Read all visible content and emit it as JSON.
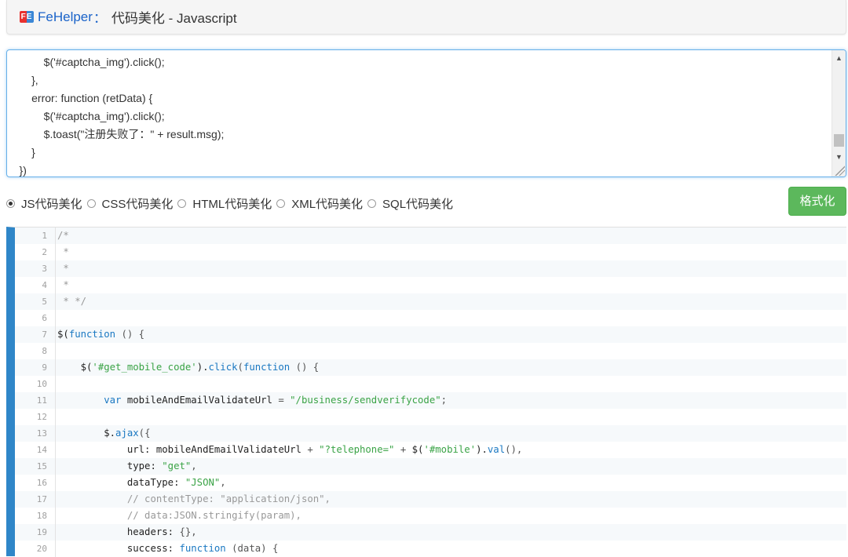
{
  "header": {
    "brand": "FeHelper",
    "separator": "：",
    "title": "代码美化 - Javascript",
    "logo_text": "FE"
  },
  "source": {
    "lines": [
      "            $('#captcha_img').click();",
      "        },",
      "        error: function (retData) {",
      "            $('#captcha_img').click();",
      "            $.toast(\"注册失败了：\" + result.msg);",
      "        }",
      "    })"
    ]
  },
  "options": [
    {
      "label": "JS代码美化",
      "checked": true
    },
    {
      "label": "CSS代码美化",
      "checked": false
    },
    {
      "label": "HTML代码美化",
      "checked": false
    },
    {
      "label": "XML代码美化",
      "checked": false
    },
    {
      "label": "SQL代码美化",
      "checked": false
    }
  ],
  "format_button": "格式化",
  "result": {
    "lines": [
      {
        "n": "1",
        "tokens": [
          [
            "c-com",
            "/*"
          ]
        ]
      },
      {
        "n": "2",
        "tokens": [
          [
            "c-com",
            " *"
          ]
        ]
      },
      {
        "n": "3",
        "tokens": [
          [
            "c-com",
            " *"
          ]
        ]
      },
      {
        "n": "4",
        "tokens": [
          [
            "c-com",
            " *"
          ]
        ]
      },
      {
        "n": "5",
        "tokens": [
          [
            "c-com",
            " * */"
          ]
        ]
      },
      {
        "n": "6",
        "tokens": []
      },
      {
        "n": "7",
        "tokens": [
          [
            "c-fn",
            "$("
          ],
          [
            "c-kw",
            "function"
          ],
          [
            "c-pun",
            " () {"
          ]
        ]
      },
      {
        "n": "8",
        "tokens": []
      },
      {
        "n": "9",
        "tokens": [
          [
            "c-fn",
            "    $("
          ],
          [
            "c-str",
            "'#get_mobile_code'"
          ],
          [
            "c-fn",
            ")."
          ],
          [
            "c-kw",
            "click"
          ],
          [
            "c-pun",
            "("
          ],
          [
            "c-kw",
            "function"
          ],
          [
            "c-pun",
            " () {"
          ]
        ]
      },
      {
        "n": "10",
        "tokens": []
      },
      {
        "n": "11",
        "tokens": [
          [
            "c-kw",
            "        var"
          ],
          [
            "c-fn",
            " mobileAndEmailValidateUrl "
          ],
          [
            "c-pun",
            "= "
          ],
          [
            "c-str",
            "\"/business/sendverifycode\""
          ],
          [
            "c-pun",
            ";"
          ]
        ]
      },
      {
        "n": "12",
        "tokens": []
      },
      {
        "n": "13",
        "tokens": [
          [
            "c-fn",
            "        $."
          ],
          [
            "c-kw",
            "ajax"
          ],
          [
            "c-pun",
            "({"
          ]
        ]
      },
      {
        "n": "14",
        "tokens": [
          [
            "c-fn",
            "            url: mobileAndEmailValidateUrl "
          ],
          [
            "c-pun",
            "+ "
          ],
          [
            "c-str",
            "\"?telephone=\""
          ],
          [
            "c-pun",
            " + "
          ],
          [
            "c-fn",
            "$("
          ],
          [
            "c-str",
            "'#mobile'"
          ],
          [
            "c-fn",
            ")."
          ],
          [
            "c-kw",
            "val"
          ],
          [
            "c-pun",
            "(),"
          ]
        ]
      },
      {
        "n": "15",
        "tokens": [
          [
            "c-fn",
            "            type: "
          ],
          [
            "c-str",
            "\"get\""
          ],
          [
            "c-pun",
            ","
          ]
        ]
      },
      {
        "n": "16",
        "tokens": [
          [
            "c-fn",
            "            dataType: "
          ],
          [
            "c-str",
            "\"JSON\""
          ],
          [
            "c-pun",
            ","
          ]
        ]
      },
      {
        "n": "17",
        "tokens": [
          [
            "c-com",
            "            // contentType: \"application/json\","
          ]
        ]
      },
      {
        "n": "18",
        "tokens": [
          [
            "c-com",
            "            // data:JSON.stringify(param),"
          ]
        ]
      },
      {
        "n": "19",
        "tokens": [
          [
            "c-fn",
            "            headers: "
          ],
          [
            "c-pun",
            "{},"
          ]
        ]
      },
      {
        "n": "20",
        "tokens": [
          [
            "c-fn",
            "            success: "
          ],
          [
            "c-kw",
            "function"
          ],
          [
            "c-pun",
            " (data) {"
          ]
        ]
      }
    ]
  }
}
